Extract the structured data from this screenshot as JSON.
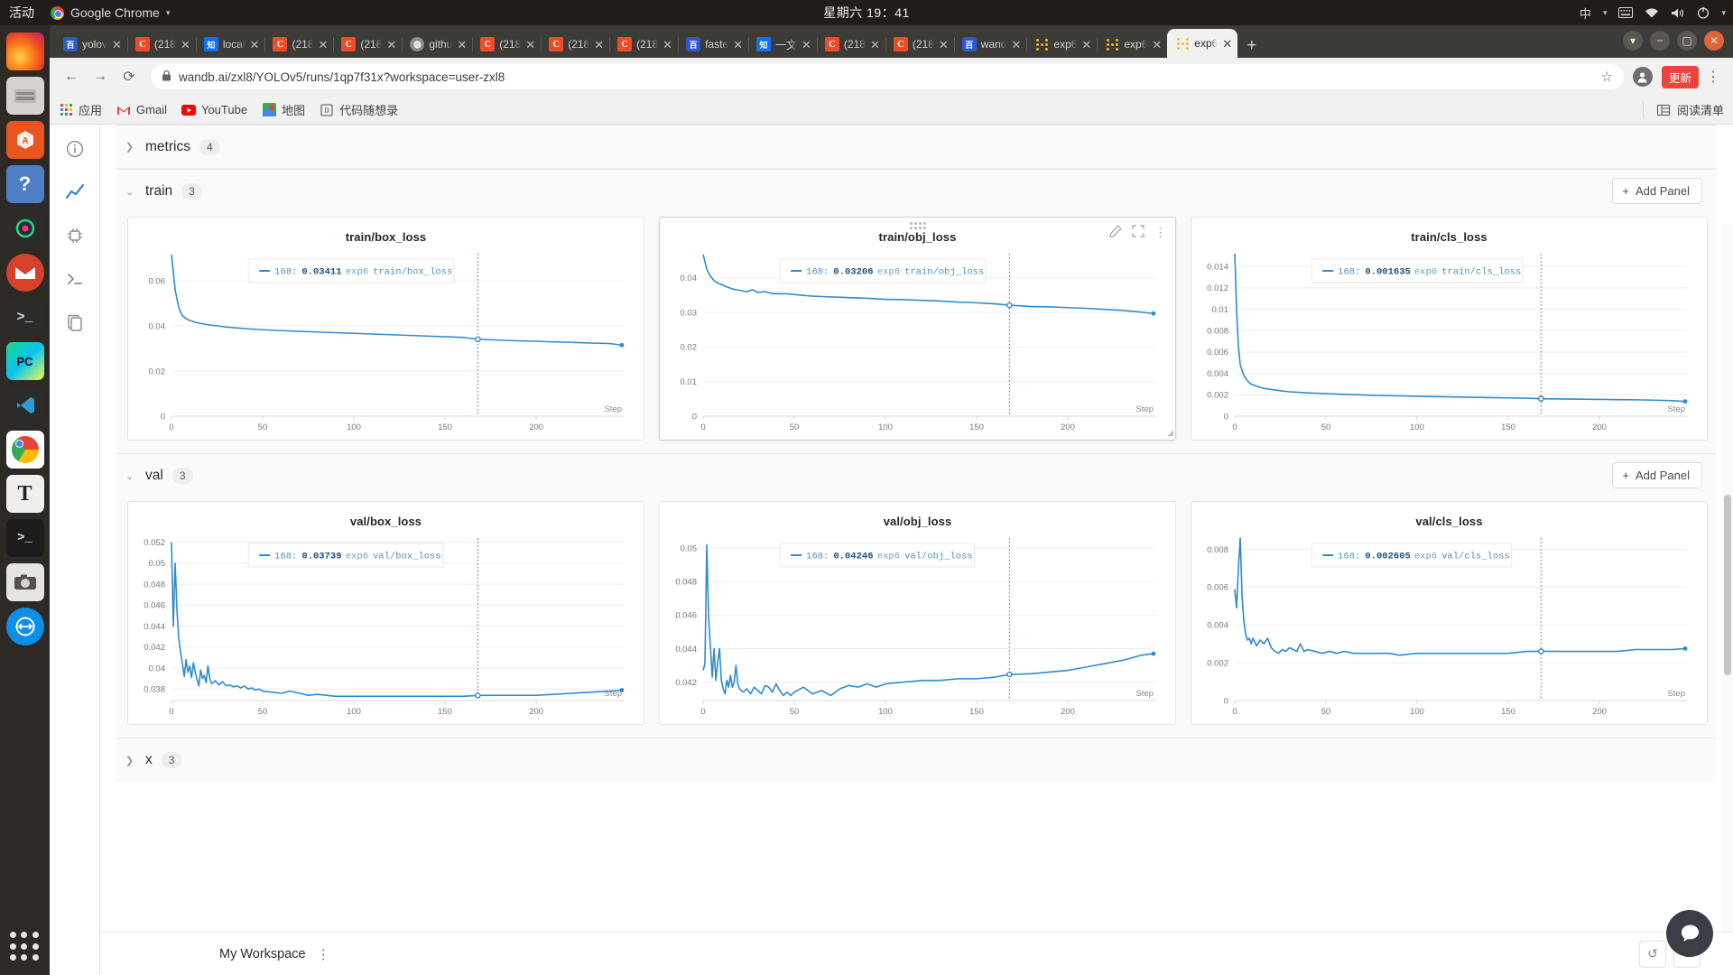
{
  "os": {
    "activities": "活动",
    "app_menu": "Google Chrome",
    "clock": "星期六 19：41",
    "input_method": "中",
    "dock_items": [
      {
        "name": "firefox",
        "label": "Firefox"
      },
      {
        "name": "files",
        "label": "Files"
      },
      {
        "name": "software",
        "label": "Ubuntu Software"
      },
      {
        "name": "help",
        "label": "Help"
      },
      {
        "name": "clion",
        "label": "CLion"
      },
      {
        "name": "thunderbird",
        "label": "Thunderbird"
      },
      {
        "name": "terminal-alt",
        "label": "Terminal"
      },
      {
        "name": "pycharm",
        "label": "PyCharm"
      },
      {
        "name": "vscode",
        "label": "Visual Studio Code"
      },
      {
        "name": "chrome",
        "label": "Google Chrome"
      },
      {
        "name": "texstudio",
        "label": "TeXstudio"
      },
      {
        "name": "terminal",
        "label": "Terminal"
      },
      {
        "name": "screenshot",
        "label": "Screenshot"
      },
      {
        "name": "teamviewer",
        "label": "TeamViewer"
      }
    ]
  },
  "browser": {
    "tabs": [
      {
        "title": "yolov",
        "favicon": "baidu",
        "active": false
      },
      {
        "title": "(218",
        "favicon": "csdn",
        "active": false
      },
      {
        "title": "local",
        "favicon": "zhihu",
        "active": false
      },
      {
        "title": "(218",
        "favicon": "csdn",
        "active": false
      },
      {
        "title": "(218",
        "favicon": "csdn",
        "active": false
      },
      {
        "title": "githu",
        "favicon": "github",
        "active": false
      },
      {
        "title": "(218",
        "favicon": "csdn",
        "active": false
      },
      {
        "title": "(218",
        "favicon": "csdn",
        "active": false
      },
      {
        "title": "(218",
        "favicon": "csdn",
        "active": false
      },
      {
        "title": "faste",
        "favicon": "baidu",
        "active": false
      },
      {
        "title": "一文",
        "favicon": "zhihu",
        "active": false
      },
      {
        "title": "(218",
        "favicon": "csdn",
        "active": false
      },
      {
        "title": "(218",
        "favicon": "csdn",
        "active": false
      },
      {
        "title": "wand",
        "favicon": "baidu",
        "active": false
      },
      {
        "title": "exp6",
        "favicon": "wandb",
        "active": false
      },
      {
        "title": "exp6",
        "favicon": "wandb",
        "active": false
      },
      {
        "title": "exp6",
        "favicon": "wandb",
        "active": true
      }
    ],
    "new_tab_label": "+",
    "url": "wandb.ai/zxl8/YOLOv5/runs/1qp7f31x?workspace=user-zxl8",
    "back_icon": "←",
    "forward_icon": "→",
    "reload_icon": "⟳",
    "lock_icon": "lock",
    "star_icon": "☆",
    "update_label": "更新",
    "bookmarks": [
      {
        "label": "应用",
        "icon": "apps-grid"
      },
      {
        "label": "Gmail",
        "icon": "gmail"
      },
      {
        "label": "YouTube",
        "icon": "youtube"
      },
      {
        "label": "地图",
        "icon": "maps"
      },
      {
        "label": "代码随想录",
        "icon": "doc"
      }
    ],
    "reading_list": "阅读清单"
  },
  "workspace": {
    "rail_icons": [
      "info-icon",
      "chart-line-icon",
      "chip-icon",
      "terminal-icon",
      "files-icon"
    ],
    "sections": [
      {
        "name": "metrics",
        "count": "4",
        "expanded": false
      },
      {
        "name": "train",
        "count": "3",
        "expanded": true
      },
      {
        "name": "val",
        "count": "3",
        "expanded": true
      },
      {
        "name": "x",
        "count": "3",
        "expanded": false
      }
    ],
    "add_panel_label": "Add Panel",
    "add_panel_icon": "+",
    "workspace_name": "My Workspace",
    "undo_icon": "↺",
    "redo_icon": "↻",
    "chat_icon": "💬",
    "panel_tools": {
      "edit": "pencil-icon",
      "fullscreen": "expand-icon",
      "more": "kebab-icon"
    }
  },
  "chart_data": [
    {
      "type": "line",
      "title": "train/box_loss",
      "xlabel": "Step",
      "ylabel": "",
      "xlim": [
        0,
        248
      ],
      "ylim": [
        0,
        0.072
      ],
      "xticks": [
        0,
        50,
        100,
        150,
        200
      ],
      "yticks": [
        0,
        0.02,
        0.04,
        0.06
      ],
      "ytick_labels": [
        "0",
        "0.02",
        "0.04",
        "0.06"
      ],
      "grid": true,
      "legend": {
        "step": "168:",
        "value": "0.03411",
        "run": "exp6",
        "key": "train/box_loss",
        "color": "#2e8bd0"
      },
      "cursor_step": 168,
      "series": [
        {
          "name": "exp6 train/box_loss",
          "x": [
            0,
            2,
            4,
            6,
            8,
            10,
            14,
            18,
            22,
            26,
            30,
            36,
            42,
            50,
            60,
            70,
            80,
            90,
            100,
            110,
            120,
            130,
            140,
            150,
            160,
            168,
            180,
            190,
            200,
            210,
            220,
            230,
            240,
            247
          ],
          "y": [
            0.0715,
            0.056,
            0.048,
            0.0445,
            0.0432,
            0.0424,
            0.0414,
            0.0408,
            0.0403,
            0.0399,
            0.0395,
            0.0391,
            0.0387,
            0.0383,
            0.0379,
            0.0376,
            0.0373,
            0.037,
            0.0367,
            0.0364,
            0.0361,
            0.0358,
            0.0355,
            0.0352,
            0.0349,
            0.0341,
            0.0337,
            0.0334,
            0.0332,
            0.0329,
            0.0327,
            0.0324,
            0.0322,
            0.0315
          ]
        }
      ]
    },
    {
      "type": "line",
      "title": "train/obj_loss",
      "xlabel": "Step",
      "ylabel": "",
      "xlim": [
        0,
        248
      ],
      "ylim": [
        0,
        0.047
      ],
      "xticks": [
        0,
        50,
        100,
        150,
        200
      ],
      "yticks": [
        0,
        0.01,
        0.02,
        0.03,
        0.04
      ],
      "ytick_labels": [
        "0",
        "0.01",
        "0.02",
        "0.03",
        "0.04"
      ],
      "grid": true,
      "legend": {
        "step": "168:",
        "value": "0.03206",
        "run": "exp6",
        "key": "train/obj_loss",
        "color": "#2e8bd0"
      },
      "cursor_step": 168,
      "hovered": true,
      "series": [
        {
          "name": "exp6 train/obj_loss",
          "x": [
            0,
            2,
            4,
            6,
            8,
            10,
            13,
            16,
            20,
            24,
            27,
            30,
            34,
            38,
            42,
            46,
            50,
            60,
            70,
            80,
            90,
            100,
            110,
            120,
            130,
            140,
            150,
            160,
            168,
            180,
            190,
            200,
            210,
            220,
            230,
            240,
            247
          ],
          "y": [
            0.0468,
            0.0425,
            0.0405,
            0.0392,
            0.0385,
            0.0381,
            0.0374,
            0.0368,
            0.0364,
            0.036,
            0.0366,
            0.0358,
            0.036,
            0.0355,
            0.0354,
            0.0354,
            0.0352,
            0.0347,
            0.0345,
            0.0343,
            0.0341,
            0.0338,
            0.0337,
            0.0335,
            0.0333,
            0.033,
            0.0328,
            0.0325,
            0.0321,
            0.0317,
            0.0316,
            0.0314,
            0.0312,
            0.0309,
            0.0306,
            0.0301,
            0.0297
          ]
        }
      ]
    },
    {
      "type": "line",
      "title": "train/cls_loss",
      "xlabel": "Step",
      "ylabel": "",
      "xlim": [
        0,
        248
      ],
      "ylim": [
        0,
        0.0152
      ],
      "xticks": [
        0,
        50,
        100,
        150,
        200
      ],
      "yticks": [
        0,
        0.002,
        0.004,
        0.006,
        0.008,
        0.01,
        0.012,
        0.014
      ],
      "ytick_labels": [
        "0",
        "0.002",
        "0.004",
        "0.006",
        "0.008",
        "0.01",
        "0.012",
        "0.014"
      ],
      "grid": true,
      "legend": {
        "step": "168:",
        "value": "0.001635",
        "run": "exp6",
        "key": "train/cls_loss",
        "color": "#2e8bd0"
      },
      "cursor_step": 168,
      "series": [
        {
          "name": "exp6 train/cls_loss",
          "x": [
            0,
            1,
            2,
            3,
            5,
            7,
            9,
            12,
            16,
            20,
            25,
            30,
            40,
            50,
            60,
            70,
            80,
            90,
            100,
            110,
            120,
            130,
            140,
            150,
            160,
            168,
            180,
            190,
            200,
            210,
            220,
            230,
            240,
            247
          ],
          "y": [
            0.0152,
            0.01,
            0.0065,
            0.0048,
            0.0038,
            0.0033,
            0.003,
            0.0028,
            0.0026,
            0.0025,
            0.00238,
            0.00228,
            0.00218,
            0.00211,
            0.00204,
            0.00199,
            0.00194,
            0.0019,
            0.00186,
            0.00183,
            0.0018,
            0.00177,
            0.00174,
            0.00171,
            0.00168,
            0.001635,
            0.00161,
            0.00159,
            0.00157,
            0.00155,
            0.00153,
            0.0015,
            0.00145,
            0.00138
          ]
        }
      ]
    },
    {
      "type": "line",
      "title": "val/box_loss",
      "xlabel": "Step",
      "ylabel": "",
      "xlim": [
        0,
        248
      ],
      "ylim": [
        0.0369,
        0.0524
      ],
      "xticks": [
        0,
        50,
        100,
        150,
        200
      ],
      "yticks": [
        0.038,
        0.04,
        0.042,
        0.044,
        0.046,
        0.048,
        0.05,
        0.052
      ],
      "ytick_labels": [
        "0.038",
        "0.04",
        "0.042",
        "0.044",
        "0.046",
        "0.048",
        "0.05",
        "0.052"
      ],
      "grid": true,
      "legend": {
        "step": "168:",
        "value": "0.03739",
        "run": "exp6",
        "key": "val/box_loss",
        "color": "#2e8bd0"
      },
      "cursor_step": 168,
      "series": [
        {
          "name": "exp6 val/box_loss",
          "x": [
            0,
            1,
            2,
            3,
            4,
            5,
            6,
            7,
            8,
            9,
            10,
            11,
            12,
            13,
            14,
            15,
            16,
            17,
            18,
            19,
            20,
            21,
            22,
            24,
            26,
            28,
            30,
            32,
            34,
            36,
            38,
            40,
            42,
            44,
            46,
            48,
            50,
            55,
            60,
            65,
            70,
            75,
            80,
            85,
            90,
            100,
            110,
            120,
            130,
            140,
            150,
            160,
            168,
            180,
            190,
            200,
            210,
            220,
            230,
            240,
            247
          ],
          "y": [
            0.052,
            0.044,
            0.05,
            0.0455,
            0.0428,
            0.0415,
            0.0404,
            0.0392,
            0.0408,
            0.0396,
            0.0402,
            0.0391,
            0.0405,
            0.0396,
            0.0389,
            0.0383,
            0.0398,
            0.039,
            0.0393,
            0.0386,
            0.0402,
            0.039,
            0.0385,
            0.0388,
            0.0384,
            0.0387,
            0.0383,
            0.0384,
            0.0382,
            0.0383,
            0.0381,
            0.0383,
            0.038,
            0.0381,
            0.0379,
            0.038,
            0.0378,
            0.0377,
            0.0376,
            0.0378,
            0.0376,
            0.0374,
            0.0375,
            0.0374,
            0.0373,
            0.0373,
            0.0373,
            0.0373,
            0.0373,
            0.0373,
            0.0373,
            0.0373,
            0.03739,
            0.0374,
            0.0374,
            0.0374,
            0.0375,
            0.0376,
            0.0377,
            0.0378,
            0.0379
          ]
        }
      ]
    },
    {
      "type": "line",
      "title": "val/obj_loss",
      "xlabel": "Step",
      "ylabel": "",
      "xlim": [
        0,
        248
      ],
      "ylim": [
        0.0409,
        0.0506
      ],
      "xticks": [
        0,
        50,
        100,
        150,
        200
      ],
      "yticks": [
        0.042,
        0.044,
        0.046,
        0.048,
        0.05
      ],
      "ytick_labels": [
        "0.042",
        "0.044",
        "0.046",
        "0.048",
        "0.05"
      ],
      "grid": true,
      "legend": {
        "step": "168:",
        "value": "0.04246",
        "run": "exp6",
        "key": "val/obj_loss",
        "color": "#2e8bd0"
      },
      "cursor_step": 168,
      "series": [
        {
          "name": "exp6 val/obj_loss",
          "x": [
            0,
            1,
            2,
            3,
            4,
            5,
            6,
            7,
            8,
            9,
            10,
            11,
            12,
            13,
            14,
            15,
            16,
            17,
            18,
            19,
            20,
            22,
            24,
            26,
            28,
            30,
            32,
            34,
            36,
            38,
            40,
            42,
            44,
            46,
            48,
            50,
            55,
            60,
            65,
            70,
            75,
            80,
            85,
            90,
            95,
            100,
            110,
            120,
            130,
            140,
            150,
            160,
            168,
            180,
            190,
            200,
            210,
            220,
            230,
            240,
            247
          ],
          "y": [
            0.0427,
            0.0431,
            0.0502,
            0.0459,
            0.0441,
            0.0423,
            0.044,
            0.0421,
            0.0432,
            0.044,
            0.0421,
            0.0416,
            0.0413,
            0.0421,
            0.0417,
            0.0424,
            0.0417,
            0.042,
            0.043,
            0.0419,
            0.0416,
            0.0414,
            0.0416,
            0.0413,
            0.0417,
            0.0415,
            0.0413,
            0.0418,
            0.0417,
            0.0414,
            0.0419,
            0.0415,
            0.0412,
            0.0414,
            0.0412,
            0.0414,
            0.0417,
            0.0413,
            0.0415,
            0.0412,
            0.0416,
            0.0418,
            0.0417,
            0.0419,
            0.0417,
            0.0419,
            0.042,
            0.0421,
            0.0421,
            0.0422,
            0.0422,
            0.0423,
            0.04246,
            0.0425,
            0.0426,
            0.0427,
            0.0429,
            0.0431,
            0.0433,
            0.0436,
            0.0437
          ]
        }
      ]
    },
    {
      "type": "line",
      "title": "val/cls_loss",
      "xlabel": "Step",
      "ylabel": "",
      "xlim": [
        0,
        248
      ],
      "ylim": [
        0,
        0.0086
      ],
      "xticks": [
        0,
        50,
        100,
        150,
        200
      ],
      "yticks": [
        0,
        0.002,
        0.004,
        0.006,
        0.008
      ],
      "ytick_labels": [
        "0",
        "0.002",
        "0.004",
        "0.006",
        "0.008"
      ],
      "grid": true,
      "legend": {
        "step": "168:",
        "value": "0.002605",
        "run": "exp6",
        "key": "val/cls_loss",
        "color": "#2e8bd0"
      },
      "cursor_step": 168,
      "series": [
        {
          "name": "exp6 val/cls_loss",
          "x": [
            0,
            1,
            2,
            3,
            4,
            5,
            6,
            7,
            8,
            9,
            10,
            12,
            14,
            16,
            18,
            20,
            22,
            24,
            26,
            28,
            30,
            32,
            34,
            36,
            38,
            40,
            44,
            48,
            52,
            56,
            60,
            65,
            70,
            75,
            80,
            85,
            90,
            100,
            110,
            120,
            130,
            140,
            150,
            160,
            168,
            180,
            190,
            200,
            210,
            220,
            230,
            240,
            247
          ],
          "y": [
            0.0059,
            0.0049,
            0.007,
            0.0086,
            0.0055,
            0.0042,
            0.0035,
            0.0032,
            0.0033,
            0.003,
            0.0033,
            0.0029,
            0.0032,
            0.003,
            0.0033,
            0.0028,
            0.0026,
            0.0025,
            0.0027,
            0.0026,
            0.0028,
            0.0027,
            0.0026,
            0.003,
            0.0026,
            0.0027,
            0.0026,
            0.0025,
            0.0026,
            0.0025,
            0.0026,
            0.0025,
            0.0025,
            0.0025,
            0.0025,
            0.0025,
            0.0024,
            0.0025,
            0.0025,
            0.0025,
            0.0025,
            0.0025,
            0.0025,
            0.0026,
            0.002605,
            0.0026,
            0.0026,
            0.0026,
            0.0026,
            0.0027,
            0.0027,
            0.0027,
            0.00275
          ]
        }
      ]
    }
  ]
}
